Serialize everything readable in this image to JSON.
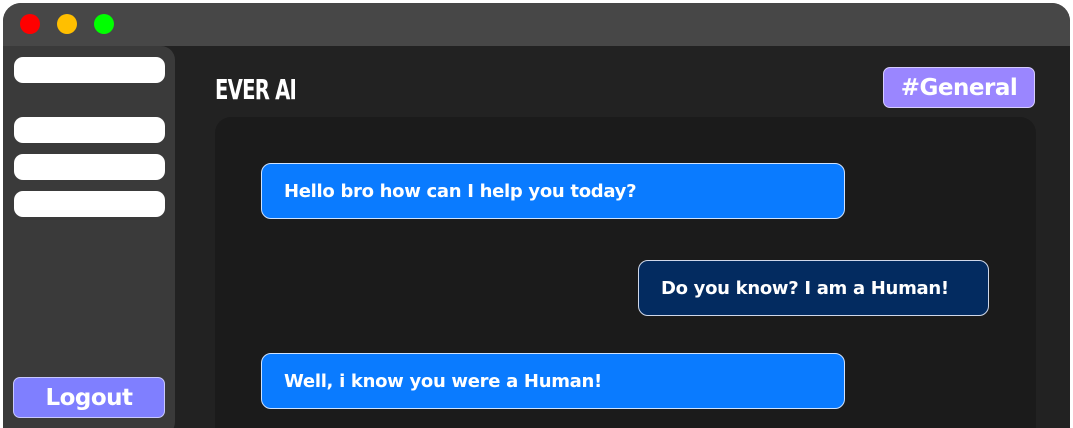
{
  "window": {
    "controls": [
      "close",
      "minimize",
      "maximize"
    ]
  },
  "header": {
    "app_title": "EVER AI",
    "channel": "#General"
  },
  "sidebar": {
    "items": [
      "",
      "",
      "",
      ""
    ],
    "logout_label": "Logout"
  },
  "chat": {
    "messages": [
      {
        "role": "bot",
        "text": "Hello bro how can I help you today?"
      },
      {
        "role": "user",
        "text": "Do you know? I am a Human!"
      },
      {
        "role": "bot",
        "text": "Well, i know you were a Human!"
      }
    ]
  },
  "colors": {
    "window_bg": "#222222",
    "titlebar": "#474747",
    "sidebar": "#3a3a3a",
    "chat_panel": "#1b1b1b",
    "bot_bubble": "#0a7bff",
    "user_bubble": "#032b60",
    "logout_button": "#7f7fff",
    "channel_tag": "#9a86ff",
    "close_dot": "#ff0000",
    "minimize_dot": "#ffbf00",
    "maximize_dot": "#00ff00"
  }
}
